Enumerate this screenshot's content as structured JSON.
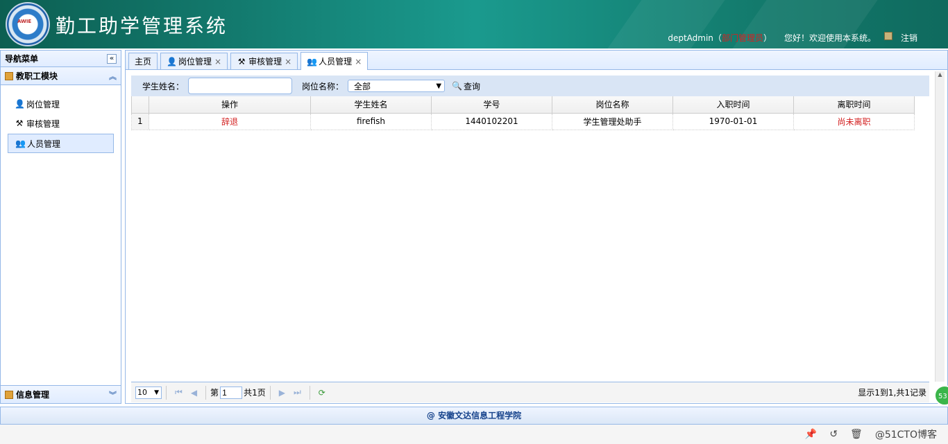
{
  "header": {
    "title": "勤工助学管理系统",
    "logo_text": "AWIE",
    "user": "deptAdmin",
    "role_open": "（",
    "role": "部门管理员",
    "role_close": "）",
    "welcome": "您好！欢迎使用本系统。",
    "logout": "注销"
  },
  "sidebar": {
    "title": "导航菜单",
    "section": "教职工模块",
    "items": [
      {
        "label": "岗位管理",
        "icon": "user-icon"
      },
      {
        "label": "审核管理",
        "icon": "hammer-icon"
      },
      {
        "label": "人员管理",
        "icon": "users-icon"
      }
    ],
    "bottom_section": "信息管理"
  },
  "tabs": [
    {
      "label": "主页",
      "closable": false
    },
    {
      "label": "岗位管理",
      "closable": true
    },
    {
      "label": "审核管理",
      "closable": true
    },
    {
      "label": "人员管理",
      "closable": true,
      "selected": true
    }
  ],
  "search": {
    "name_label": "学生姓名：",
    "name_value": "",
    "post_label": "岗位名称：",
    "post_value": "全部",
    "query_label": "查询"
  },
  "table": {
    "columns": [
      "操作",
      "学生姓名",
      "学号",
      "岗位名称",
      "入职时间",
      "离职时间"
    ],
    "rows": [
      {
        "index": "1",
        "action": "辞退",
        "name": "firefish",
        "id": "1440102201",
        "post": "学生管理处助手",
        "start": "1970-01-01",
        "end": "尚未离职"
      }
    ]
  },
  "pager": {
    "page_size": "10",
    "page_prefix": "第",
    "page_value": "1",
    "page_total": "共1页",
    "info": "显示1到1,共1记录"
  },
  "footer": "@ 安徽文达信息工程学院",
  "watermark": "@51CTO博客",
  "badge": "53"
}
